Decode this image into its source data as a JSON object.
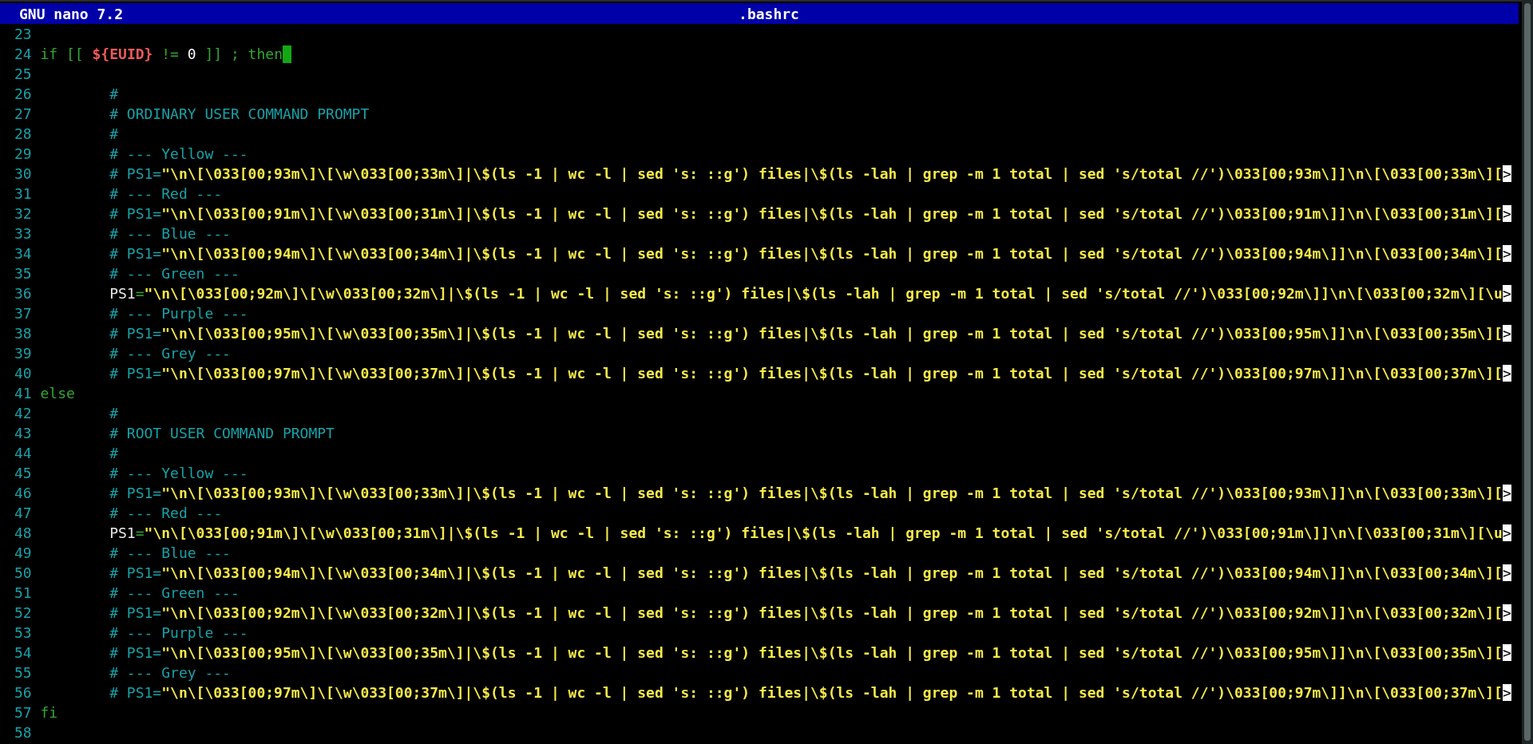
{
  "title_bar": {
    "app": "GNU nano 7.2",
    "file": ".bashrc"
  },
  "lines": [
    {
      "number": "23",
      "cursor": false
    },
    {
      "number": "24",
      "indented": false,
      "cursor": true,
      "segments": [
        {
          "kind": "keyword",
          "text": "if [[ "
        },
        {
          "kind": "variable",
          "text": "${EUID}"
        },
        {
          "kind": "keyword",
          "text": " != "
        },
        {
          "kind": "literal",
          "text": "0"
        },
        {
          "kind": "keyword",
          "text": " ]] ; then"
        }
      ]
    },
    {
      "number": "25",
      "cursor": false
    },
    {
      "number": "26",
      "indented": true,
      "cursor": false,
      "segments": [
        {
          "kind": "comment",
          "text": "#"
        }
      ]
    },
    {
      "number": "27",
      "indented": true,
      "cursor": false,
      "segments": [
        {
          "kind": "comment",
          "text": "# ORDINARY USER COMMAND PROMPT"
        }
      ]
    },
    {
      "number": "28",
      "indented": true,
      "cursor": false,
      "segments": [
        {
          "kind": "comment",
          "text": "#"
        }
      ]
    },
    {
      "number": "29",
      "indented": true,
      "cursor": false,
      "segments": [
        {
          "kind": "comment",
          "text": "# --- Yellow ---"
        }
      ]
    },
    {
      "number": "30",
      "indented": true,
      "cursor": false,
      "overflow_marker": ">",
      "segments": [
        {
          "kind": "comment",
          "text": "# PS1="
        },
        {
          "kind": "string",
          "text": "\"\\n\\[\\033[00;93m\\]\\[\\w\\033[00;33m\\]|\\$(ls -1 | wc -l | sed 's: ::g') files|\\$(ls -lah | grep -m 1 total | sed 's/total //')\\033[00;93m\\]]\\n\\[\\033[00;33m\\]["
        }
      ]
    },
    {
      "number": "31",
      "indented": true,
      "cursor": false,
      "segments": [
        {
          "kind": "comment",
          "text": "# --- Red ---"
        }
      ]
    },
    {
      "number": "32",
      "indented": true,
      "cursor": false,
      "overflow_marker": ">",
      "segments": [
        {
          "kind": "comment",
          "text": "# PS1="
        },
        {
          "kind": "string",
          "text": "\"\\n\\[\\033[00;91m\\]\\[\\w\\033[00;31m\\]|\\$(ls -1 | wc -l | sed 's: ::g') files|\\$(ls -lah | grep -m 1 total | sed 's/total //')\\033[00;91m\\]]\\n\\[\\033[00;31m\\]["
        }
      ]
    },
    {
      "number": "33",
      "indented": true,
      "cursor": false,
      "segments": [
        {
          "kind": "comment",
          "text": "# --- Blue ---"
        }
      ]
    },
    {
      "number": "34",
      "indented": true,
      "cursor": false,
      "overflow_marker": ">",
      "segments": [
        {
          "kind": "comment",
          "text": "# PS1="
        },
        {
          "kind": "string",
          "text": "\"\\n\\[\\033[00;94m\\]\\[\\w\\033[00;34m\\]|\\$(ls -1 | wc -l | sed 's: ::g') files|\\$(ls -lah | grep -m 1 total | sed 's/total //')\\033[00;94m\\]]\\n\\[\\033[00;34m\\]["
        }
      ]
    },
    {
      "number": "35",
      "indented": true,
      "cursor": false,
      "segments": [
        {
          "kind": "comment",
          "text": "# --- Green ---"
        }
      ]
    },
    {
      "number": "36",
      "indented": true,
      "cursor": false,
      "overflow_marker": ">",
      "segments": [
        {
          "kind": "plain",
          "text": "PS1"
        },
        {
          "kind": "keyword",
          "text": "="
        },
        {
          "kind": "string",
          "text": "\"\\n\\[\\033[00;92m\\]\\[\\w\\033[00;32m\\]|\\$(ls -1 | wc -l | sed 's: ::g') files|\\$(ls -lah | grep -m 1 total | sed 's/total //')\\033[00;92m\\]]\\n\\[\\033[00;32m\\][\\u"
        }
      ]
    },
    {
      "number": "37",
      "indented": true,
      "cursor": false,
      "segments": [
        {
          "kind": "comment",
          "text": "# --- Purple ---"
        }
      ]
    },
    {
      "number": "38",
      "indented": true,
      "cursor": false,
      "overflow_marker": ">",
      "segments": [
        {
          "kind": "comment",
          "text": "# PS1="
        },
        {
          "kind": "string",
          "text": "\"\\n\\[\\033[00;95m\\]\\[\\w\\033[00;35m\\]|\\$(ls -1 | wc -l | sed 's: ::g') files|\\$(ls -lah | grep -m 1 total | sed 's/total //')\\033[00;95m\\]]\\n\\[\\033[00;35m\\]["
        }
      ]
    },
    {
      "number": "39",
      "indented": true,
      "cursor": false,
      "segments": [
        {
          "kind": "comment",
          "text": "# --- Grey ---"
        }
      ]
    },
    {
      "number": "40",
      "indented": true,
      "cursor": false,
      "overflow_marker": ">",
      "segments": [
        {
          "kind": "comment",
          "text": "# PS1="
        },
        {
          "kind": "string",
          "text": "\"\\n\\[\\033[00;97m\\]\\[\\w\\033[00;37m\\]|\\$(ls -1 | wc -l | sed 's: ::g') files|\\$(ls -lah | grep -m 1 total | sed 's/total //')\\033[00;97m\\]]\\n\\[\\033[00;37m\\]["
        }
      ]
    },
    {
      "number": "41",
      "indented": false,
      "cursor": false,
      "segments": [
        {
          "kind": "keyword",
          "text": "else"
        }
      ]
    },
    {
      "number": "42",
      "indented": true,
      "cursor": false,
      "segments": [
        {
          "kind": "comment",
          "text": "#"
        }
      ]
    },
    {
      "number": "43",
      "indented": true,
      "cursor": false,
      "segments": [
        {
          "kind": "comment",
          "text": "# ROOT USER COMMAND PROMPT"
        }
      ]
    },
    {
      "number": "44",
      "indented": true,
      "cursor": false,
      "segments": [
        {
          "kind": "comment",
          "text": "#"
        }
      ]
    },
    {
      "number": "45",
      "indented": true,
      "cursor": false,
      "segments": [
        {
          "kind": "comment",
          "text": "# --- Yellow ---"
        }
      ]
    },
    {
      "number": "46",
      "indented": true,
      "cursor": false,
      "overflow_marker": ">",
      "segments": [
        {
          "kind": "comment",
          "text": "# PS1="
        },
        {
          "kind": "string",
          "text": "\"\\n\\[\\033[00;93m\\]\\[\\w\\033[00;33m\\]|\\$(ls -1 | wc -l | sed 's: ::g') files|\\$(ls -lah | grep -m 1 total | sed 's/total //')\\033[00;93m\\]]\\n\\[\\033[00;33m\\]["
        }
      ]
    },
    {
      "number": "47",
      "indented": true,
      "cursor": false,
      "segments": [
        {
          "kind": "comment",
          "text": "# --- Red ---"
        }
      ]
    },
    {
      "number": "48",
      "indented": true,
      "cursor": false,
      "overflow_marker": ">",
      "segments": [
        {
          "kind": "plain",
          "text": "PS1"
        },
        {
          "kind": "keyword",
          "text": "="
        },
        {
          "kind": "string",
          "text": "\"\\n\\[\\033[00;91m\\]\\[\\w\\033[00;31m\\]|\\$(ls -1 | wc -l | sed 's: ::g') files|\\$(ls -lah | grep -m 1 total | sed 's/total //')\\033[00;91m\\]]\\n\\[\\033[00;31m\\][\\u"
        }
      ]
    },
    {
      "number": "49",
      "indented": true,
      "cursor": false,
      "segments": [
        {
          "kind": "comment",
          "text": "# --- Blue ---"
        }
      ]
    },
    {
      "number": "50",
      "indented": true,
      "cursor": false,
      "overflow_marker": ">",
      "segments": [
        {
          "kind": "comment",
          "text": "# PS1="
        },
        {
          "kind": "string",
          "text": "\"\\n\\[\\033[00;94m\\]\\[\\w\\033[00;34m\\]|\\$(ls -1 | wc -l | sed 's: ::g') files|\\$(ls -lah | grep -m 1 total | sed 's/total //')\\033[00;94m\\]]\\n\\[\\033[00;34m\\]["
        }
      ]
    },
    {
      "number": "51",
      "indented": true,
      "cursor": false,
      "segments": [
        {
          "kind": "comment",
          "text": "# --- Green ---"
        }
      ]
    },
    {
      "number": "52",
      "indented": true,
      "cursor": false,
      "overflow_marker": ">",
      "segments": [
        {
          "kind": "comment",
          "text": "# PS1="
        },
        {
          "kind": "string",
          "text": "\"\\n\\[\\033[00;92m\\]\\[\\w\\033[00;32m\\]|\\$(ls -1 | wc -l | sed 's: ::g') files|\\$(ls -lah | grep -m 1 total | sed 's/total //')\\033[00;92m\\]]\\n\\[\\033[00;32m\\]["
        }
      ]
    },
    {
      "number": "53",
      "indented": true,
      "cursor": false,
      "segments": [
        {
          "kind": "comment",
          "text": "# --- Purple ---"
        }
      ]
    },
    {
      "number": "54",
      "indented": true,
      "cursor": false,
      "overflow_marker": ">",
      "segments": [
        {
          "kind": "comment",
          "text": "# PS1="
        },
        {
          "kind": "string",
          "text": "\"\\n\\[\\033[00;95m\\]\\[\\w\\033[00;35m\\]|\\$(ls -1 | wc -l | sed 's: ::g') files|\\$(ls -lah | grep -m 1 total | sed 's/total //')\\033[00;95m\\]]\\n\\[\\033[00;35m\\]["
        }
      ]
    },
    {
      "number": "55",
      "indented": true,
      "cursor": false,
      "segments": [
        {
          "kind": "comment",
          "text": "# --- Grey ---"
        }
      ]
    },
    {
      "number": "56",
      "indented": true,
      "cursor": false,
      "overflow_marker": ">",
      "segments": [
        {
          "kind": "comment",
          "text": "# PS1="
        },
        {
          "kind": "string",
          "text": "\"\\n\\[\\033[00;97m\\]\\[\\w\\033[00;37m\\]|\\$(ls -1 | wc -l | sed 's: ::g') files|\\$(ls -lah | grep -m 1 total | sed 's/total //')\\033[00;97m\\]]\\n\\[\\033[00;37m\\]["
        }
      ]
    },
    {
      "number": "57",
      "indented": false,
      "cursor": false,
      "segments": [
        {
          "kind": "keyword",
          "text": "fi"
        }
      ]
    },
    {
      "number": "58",
      "cursor": false
    }
  ]
}
